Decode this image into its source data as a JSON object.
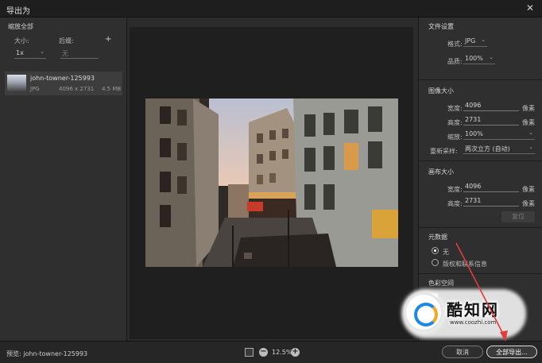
{
  "window": {
    "title": "导出为",
    "close_glyph": "✕"
  },
  "left": {
    "section_title": "缩放全部",
    "size_label": "大小:",
    "suffix_label": "后缀:",
    "add_glyph": "+",
    "size_value": "1x",
    "suffix_placeholder": "无",
    "file": {
      "name": "john-towner-125993",
      "type": "JPG",
      "dimensions": "4096 x 2731",
      "size": "4.5 MB"
    }
  },
  "right": {
    "file_settings": {
      "title": "文件设置",
      "format_label": "格式:",
      "format_value": "JPG",
      "quality_label": "品质:",
      "quality_value": "100%"
    },
    "image_size": {
      "title": "图像大小",
      "width_label": "宽度:",
      "width_value": "4096",
      "height_label": "高度:",
      "height_value": "2731",
      "scale_label": "缩放:",
      "scale_value": "100%",
      "resample_label": "重新采样:",
      "resample_value": "两次立方 (自动)",
      "unit": "像素"
    },
    "canvas_size": {
      "title": "画布大小",
      "width_label": "宽度:",
      "width_value": "4096",
      "height_label": "高度:",
      "height_value": "2731",
      "unit": "像素",
      "reset_label": "复位"
    },
    "metadata": {
      "title": "元数据",
      "option_none": "无",
      "option_copyright": "版权和联系信息"
    },
    "color_space": {
      "title": "色彩空间"
    }
  },
  "bottom": {
    "preview_label": "预览: john-towner-125993",
    "zoom_value": "12.5%",
    "zoom_minus": "−",
    "zoom_plus": "+",
    "cancel_label": "取消",
    "export_all_label": "全部导出..."
  },
  "watermark": {
    "brand": "酷知网",
    "url": "www.coozhi.com"
  },
  "colors": {
    "accent_arrow": "#e23b3b",
    "panel": "#2f2f2f",
    "canvas": "#1f1f1f"
  }
}
